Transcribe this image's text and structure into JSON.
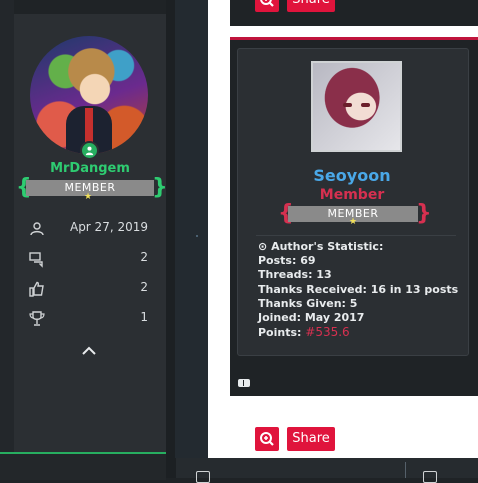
{
  "top_post": {
    "share_label": "Share"
  },
  "left_profile": {
    "username": "MrDangem",
    "rank_label": "MEMBER",
    "stats": [
      {
        "icon": "user-icon",
        "value": "Apr 27, 2019"
      },
      {
        "icon": "messages-icon",
        "value": "2"
      },
      {
        "icon": "thumbs-up-icon",
        "value": "2"
      },
      {
        "icon": "trophy-icon",
        "value": "1"
      }
    ],
    "colors": {
      "username": "#2ecc71",
      "brace": "#2ecc71"
    }
  },
  "author": {
    "name": "Seoyoon",
    "title": "Member",
    "rank_label": "MEMBER",
    "statistic_heading": "Author's Statistic:",
    "stats": {
      "posts": "Posts: 69",
      "threads": "Threads: 13",
      "thanks_received": "Thanks Received: 16 in 13 posts",
      "thanks_given": "Thanks Given: 5",
      "joined": "Joined: May 2017",
      "points_label": "Points:",
      "points_value": "#535.6"
    },
    "colors": {
      "name": "#4aa8e8",
      "title": "#d63050",
      "brace": "#d63050"
    }
  },
  "bottom_post": {
    "share_label": "Share"
  },
  "colors": {
    "accent": "#e0143c",
    "divider": "#c0143c"
  }
}
